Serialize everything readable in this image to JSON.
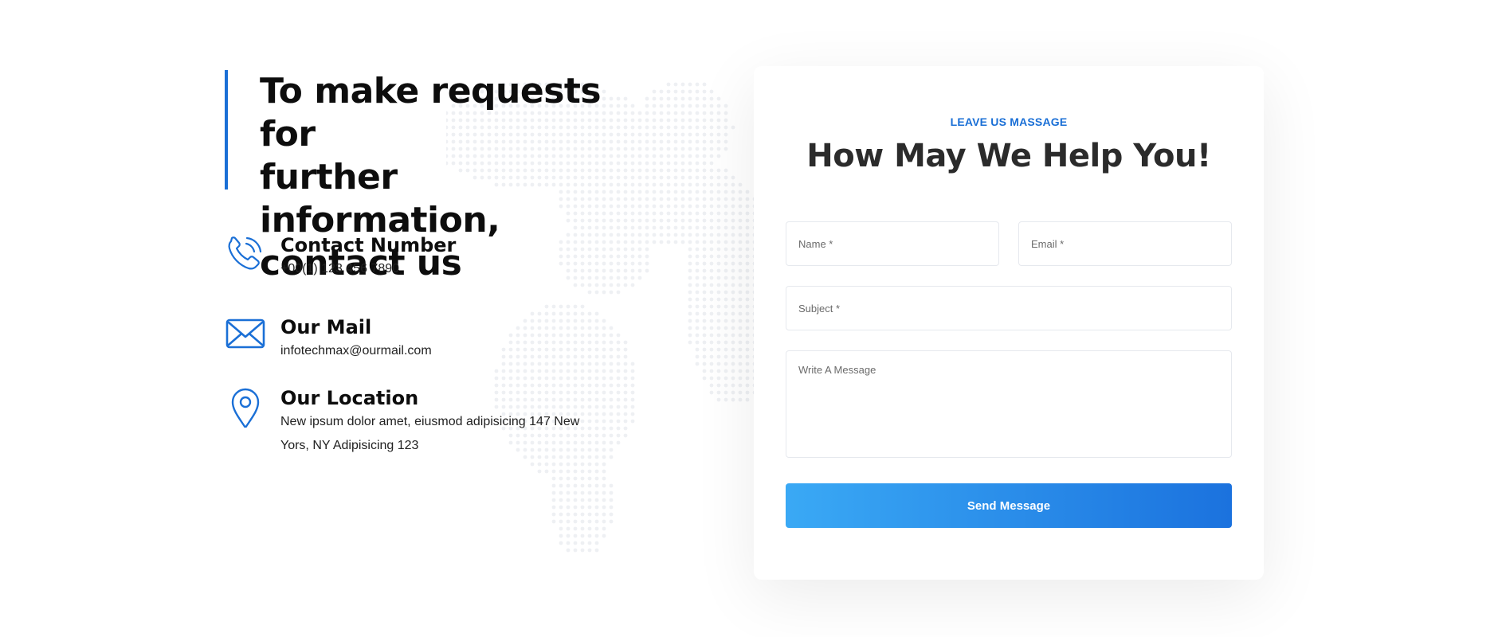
{
  "heading": {
    "line1": "To make requests for",
    "line2": "further information,",
    "line3": "contact us"
  },
  "contact_items": [
    {
      "icon": "phone-icon",
      "title": "Contact Number",
      "text": "+00(1) 123 456 7890"
    },
    {
      "icon": "mail-icon",
      "title": "Our Mail",
      "text": "infotechmax@ourmail.com"
    },
    {
      "icon": "location-pin-icon",
      "title": "Our Location",
      "text": "New ipsum dolor amet, eiusmod adipisicing 147 New Yors, NY Adipisicing 123"
    }
  ],
  "form": {
    "eyebrow": "LEAVE US MASSAGE",
    "title": "How May We Help You!",
    "name_placeholder": "Name *",
    "email_placeholder": "Email *",
    "subject_placeholder": "Subject *",
    "message_placeholder": "Write A Message",
    "submit_label": "Send Message"
  },
  "colors": {
    "accent": "#1a6fd6",
    "button_gradient_start": "#3aa9f5",
    "button_gradient_end": "#1b72de"
  }
}
